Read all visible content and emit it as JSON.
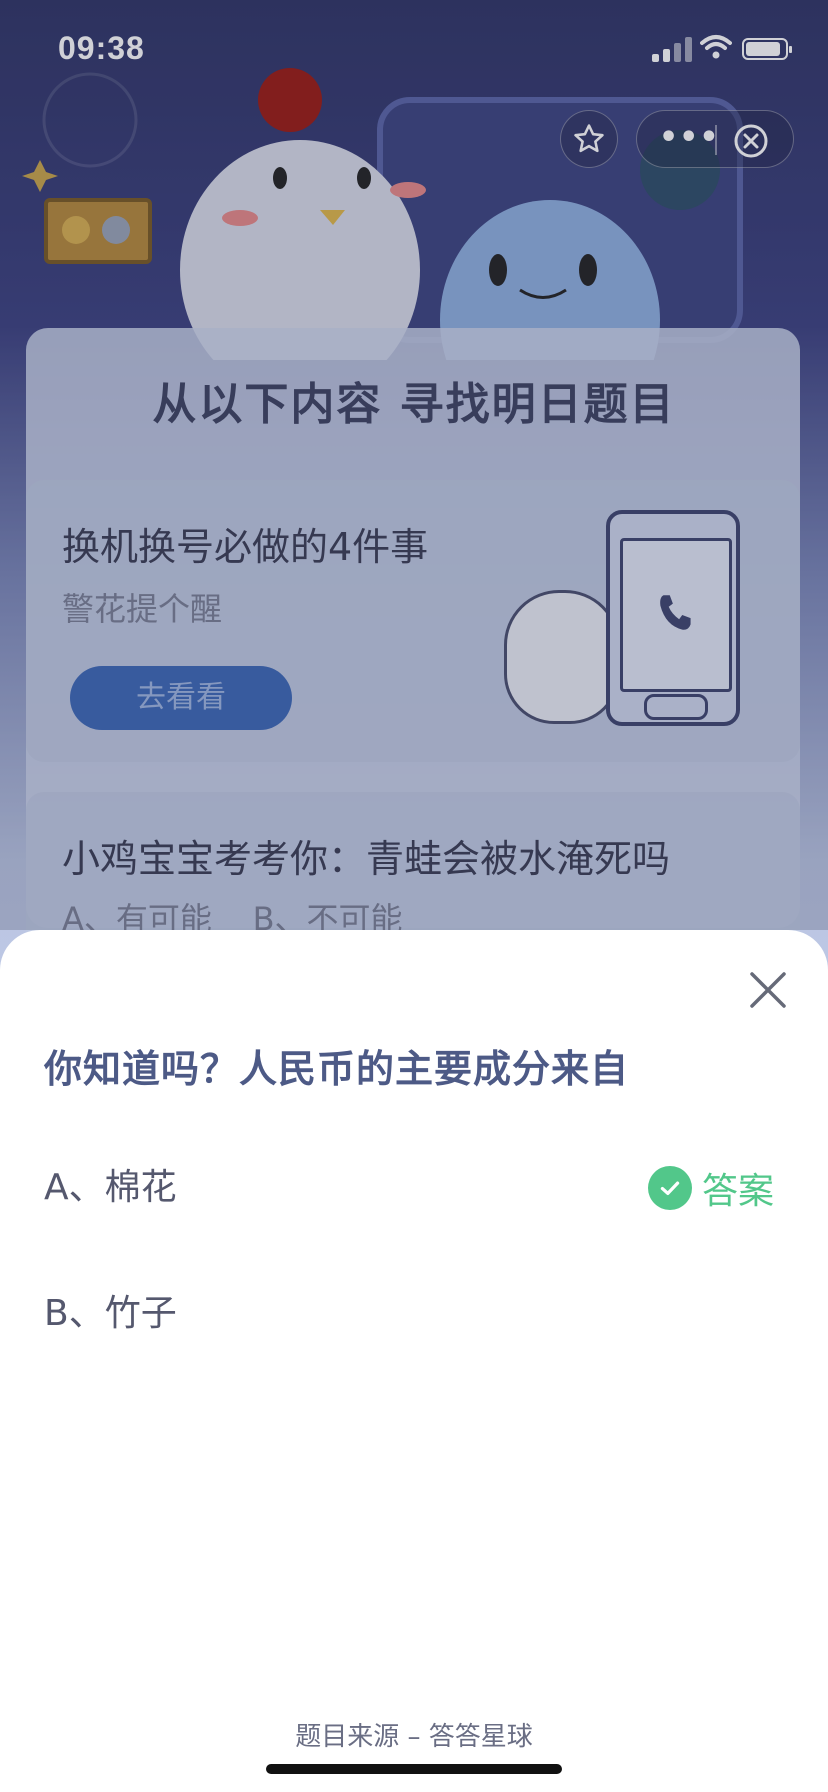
{
  "status_bar": {
    "time": "09:38"
  },
  "background": {
    "headline": "从以下内容 寻找明日题目",
    "card1": {
      "title": "换机换号必做的4件事",
      "subtitle": "警花提个醒",
      "button": "去看看"
    },
    "card2": {
      "title": "小鸡宝宝考考你：青蛙会被水淹死吗",
      "options": "A、有可能    B、不可能"
    }
  },
  "sheet": {
    "question": "你知道吗？人民币的主要成分来自",
    "option_a": "A、棉花",
    "option_b": "B、竹子",
    "answer_label": "答案",
    "answer_color": "#52c78a",
    "source": "题目来源 – 答答星球"
  },
  "icons": [
    "star-icon",
    "more-icon",
    "close-circle-icon",
    "close-icon",
    "check-icon",
    "phone-call-icon"
  ]
}
